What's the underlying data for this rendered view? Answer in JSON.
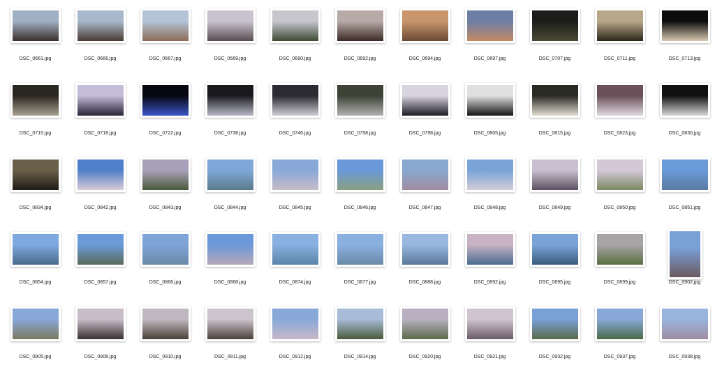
{
  "files": [
    {
      "name": "DSC_0661.jpg",
      "tone": [
        "#9fb0c4",
        "#3a2e28"
      ]
    },
    {
      "name": "DSC_0666.jpg",
      "tone": [
        "#a9b8cc",
        "#4a3a30"
      ]
    },
    {
      "name": "DSC_0667.jpg",
      "tone": [
        "#b4c3d6",
        "#8a6a56"
      ]
    },
    {
      "name": "DSC_0669.jpg",
      "tone": [
        "#c9c3cf",
        "#5a4c50"
      ]
    },
    {
      "name": "DSC_0690.jpg",
      "tone": [
        "#c6c6cc",
        "#3c4a34"
      ]
    },
    {
      "name": "DSC_0692.jpg",
      "tone": [
        "#b8aaa6",
        "#3a2a26"
      ]
    },
    {
      "name": "DSC_0694.jpg",
      "tone": [
        "#c8956c",
        "#6a4a34"
      ]
    },
    {
      "name": "DSC_0697.jpg",
      "tone": [
        "#6c7ea4",
        "#c48a64"
      ]
    },
    {
      "name": "DSC_0707.jpg",
      "tone": [
        "#1c1c1a",
        "#4a4a36"
      ]
    },
    {
      "name": "DSC_0711.jpg",
      "tone": [
        "#b8a88a",
        "#2a2418"
      ]
    },
    {
      "name": "DSC_0713.jpg",
      "tone": [
        "#0c0c0c",
        "#d8cab0"
      ]
    },
    {
      "name": "DSC_0715.jpg",
      "tone": [
        "#2a2620",
        "#a8a090"
      ]
    },
    {
      "name": "DSC_0718.jpg",
      "tone": [
        "#c4bcd8",
        "#2a2236"
      ]
    },
    {
      "name": "DSC_0722.jpg",
      "tone": [
        "#060610",
        "#3a56c8"
      ]
    },
    {
      "name": "DSC_0738.jpg",
      "tone": [
        "#1a1a1e",
        "#b8b8c8"
      ]
    },
    {
      "name": "DSC_0746.jpg",
      "tone": [
        "#2a2a30",
        "#d0ccd4"
      ]
    },
    {
      "name": "DSC_0758.jpg",
      "tone": [
        "#3c4234",
        "#b0b0b0"
      ]
    },
    {
      "name": "DSC_0798.jpg",
      "tone": [
        "#d8d4e0",
        "#1a1a24"
      ]
    },
    {
      "name": "DSC_0805.jpg",
      "tone": [
        "#e0e0e0",
        "#141414"
      ]
    },
    {
      "name": "DSC_0815.jpg",
      "tone": [
        "#2a2a24",
        "#e0dcd0"
      ]
    },
    {
      "name": "DSC_0823.jpg",
      "tone": [
        "#6a5058",
        "#e0d8e0"
      ]
    },
    {
      "name": "DSC_0830.jpg",
      "tone": [
        "#101010",
        "#d8d8d8"
      ]
    },
    {
      "name": "DSC_0834.jpg",
      "tone": [
        "#6a604a",
        "#1e1a14"
      ]
    },
    {
      "name": "DSC_0842.jpg",
      "tone": [
        "#4f7fc8",
        "#d8ccd8"
      ]
    },
    {
      "name": "DSC_0843.jpg",
      "tone": [
        "#a8a0b8",
        "#4a5a3a"
      ]
    },
    {
      "name": "DSC_0844.jpg",
      "tone": [
        "#7fa8d8",
        "#5a7a8a"
      ]
    },
    {
      "name": "DSC_0845.jpg",
      "tone": [
        "#88a8d8",
        "#c8bcc8"
      ]
    },
    {
      "name": "DSC_0846.jpg",
      "tone": [
        "#6a98d8",
        "#8aa080"
      ]
    },
    {
      "name": "DSC_0847.jpg",
      "tone": [
        "#88a8d0",
        "#a08ca0"
      ]
    },
    {
      "name": "DSC_0848.jpg",
      "tone": [
        "#7aa4d8",
        "#d4ccd8"
      ]
    },
    {
      "name": "DSC_0849.jpg",
      "tone": [
        "#c8c0d0",
        "#5a5060"
      ]
    },
    {
      "name": "DSC_0850.jpg",
      "tone": [
        "#d4c8d8",
        "#7a8a60"
      ]
    },
    {
      "name": "DSC_0851.jpg",
      "tone": [
        "#6a9ad8",
        "#5a7aa0"
      ]
    },
    {
      "name": "DSC_0854.jpg",
      "tone": [
        "#7ea8e0",
        "#4a6a8a"
      ]
    },
    {
      "name": "DSC_0857.jpg",
      "tone": [
        "#6a9ad8",
        "#5a6a5a"
      ]
    },
    {
      "name": "DSC_0866.jpg",
      "tone": [
        "#7ea4d8",
        "#6a8aa8"
      ]
    },
    {
      "name": "DSC_0868.jpg",
      "tone": [
        "#6a98d8",
        "#b8a8b8"
      ]
    },
    {
      "name": "DSC_0874.jpg",
      "tone": [
        "#88b0e0",
        "#5a84a8"
      ]
    },
    {
      "name": "DSC_0877.jpg",
      "tone": [
        "#8ab0e0",
        "#6a8aa8"
      ]
    },
    {
      "name": "DSC_0888.jpg",
      "tone": [
        "#98b8e0",
        "#5a7898"
      ]
    },
    {
      "name": "DSC_0892.jpg",
      "tone": [
        "#c8b4c4",
        "#4a6a90"
      ]
    },
    {
      "name": "DSC_0895.jpg",
      "tone": [
        "#7aa4d8",
        "#3a5a7a"
      ]
    },
    {
      "name": "DSC_0899.jpg",
      "tone": [
        "#a8a4a8",
        "#5a7040"
      ]
    },
    {
      "name": "DSC_0902.jpg",
      "tone": [
        "#7aa0d8",
        "#6a5a60"
      ],
      "portrait": true
    },
    {
      "name": "DSC_0905.jpg",
      "tone": [
        "#88a8d8",
        "#7a7a60"
      ]
    },
    {
      "name": "DSC_0906.jpg",
      "tone": [
        "#c8bcc8",
        "#3a3030"
      ]
    },
    {
      "name": "DSC_0910.jpg",
      "tone": [
        "#c0b8c0",
        "#4a4038"
      ]
    },
    {
      "name": "DSC_0911.jpg",
      "tone": [
        "#ccc4cc",
        "#4a403a"
      ]
    },
    {
      "name": "DSC_0912.jpg",
      "tone": [
        "#88a8d8",
        "#c8b8c8"
      ]
    },
    {
      "name": "DSC_0914.jpg",
      "tone": [
        "#a8bcd8",
        "#4a5a3a"
      ]
    },
    {
      "name": "DSC_0920.jpg",
      "tone": [
        "#b8b0c0",
        "#5a6a4a"
      ]
    },
    {
      "name": "DSC_0921.jpg",
      "tone": [
        "#d0c4d0",
        "#6a5a68"
      ]
    },
    {
      "name": "DSC_0932.jpg",
      "tone": [
        "#7aa0d8",
        "#5a6a4a"
      ]
    },
    {
      "name": "DSC_0937.jpg",
      "tone": [
        "#88a8d8",
        "#4a6a4a"
      ]
    },
    {
      "name": "DSC_0938.jpg",
      "tone": [
        "#98b4dc",
        "#a08ca0"
      ]
    }
  ]
}
